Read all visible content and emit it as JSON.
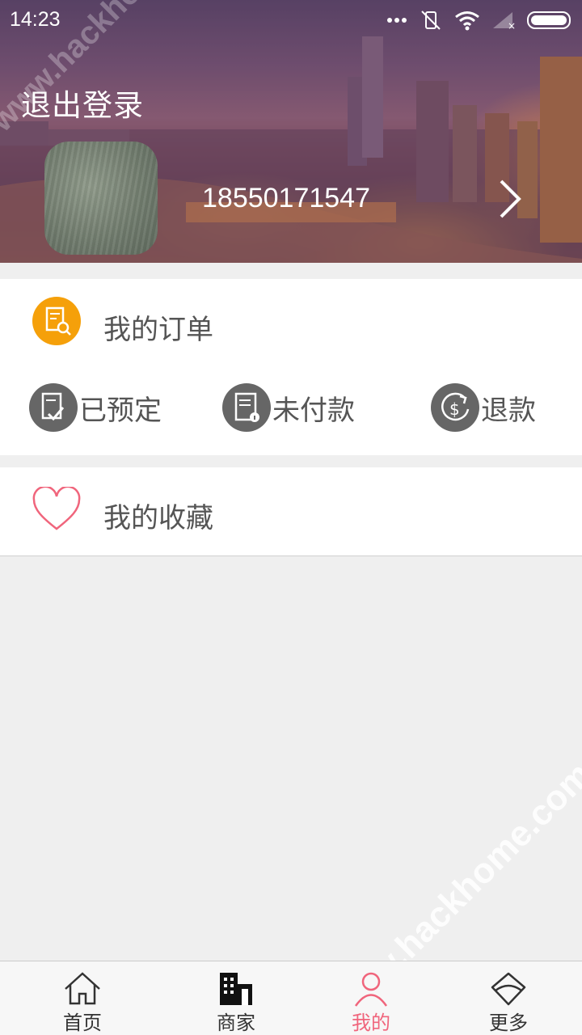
{
  "status_bar": {
    "time": "14:23"
  },
  "header": {
    "logout_label": "退出登录",
    "phone": "18550171547"
  },
  "orders": {
    "title": "我的订单",
    "items": [
      {
        "label": "已预定",
        "icon": "booked-icon"
      },
      {
        "label": "未付款",
        "icon": "unpaid-icon"
      },
      {
        "label": "退款",
        "icon": "refund-icon"
      }
    ]
  },
  "favorites": {
    "title": "我的收藏"
  },
  "tabbar": {
    "tabs": [
      {
        "label": "首页",
        "icon": "home-icon"
      },
      {
        "label": "商家",
        "icon": "building-icon"
      },
      {
        "label": "我的",
        "icon": "person-icon",
        "active": true
      },
      {
        "label": "更多",
        "icon": "more-icon"
      }
    ]
  },
  "colors": {
    "accent": "#f0657c",
    "orange": "#f5a00a",
    "grey_icon": "#666666",
    "heart": "#f0657c"
  },
  "watermark": "www.hackhome.com"
}
